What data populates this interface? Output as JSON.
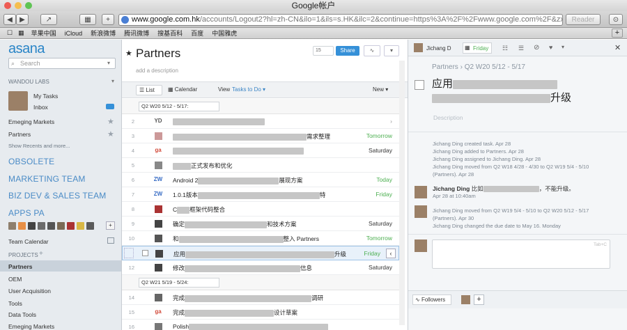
{
  "window": {
    "title": "Google帐户"
  },
  "browser": {
    "url_host": "www.google.com.hk",
    "url_rest": "/accounts/Logout2?hl=zh-CN&ilo=1&ils=s.HK&ilc=2&continue=https%3A%2F%2Fwww.google.com%2F&zx=",
    "reader": "Reader",
    "bookmarks": [
      "苹果中国",
      "iCloud",
      "新浪微博",
      "腾讯微博",
      "搜基百科",
      "百度",
      "中国雅虎"
    ]
  },
  "sidebar": {
    "logo": "asana",
    "search_placeholder": "Search",
    "workspace": "WANDOU LABS",
    "my_tasks": "My Tasks",
    "inbox": "Inbox",
    "fav1": "Emeging Markets",
    "fav2": "Partners",
    "show_recent": "Show Recents and more...",
    "teams": [
      "OBSOLETE",
      "MARKETING TEAM",
      "BIZ DEV & SALES TEAM",
      "APPS PA"
    ],
    "team_calendar": "Team Calendar",
    "projects_header": "PROJECTS",
    "projects": [
      "Partners",
      "OEM",
      "User Acquisition",
      "Tools",
      "Data Tools",
      "Emeging Markets"
    ]
  },
  "main": {
    "title": "Partners",
    "description_placeholder": "add a description",
    "follower_count": "15",
    "share": "Share",
    "view_label": "View",
    "tasks_filter": "Tasks to Do",
    "list_tab": "List",
    "calendar_tab": "Calendar",
    "new_label": "New",
    "section1": "Q2 W20 5/12 - 5/17:",
    "section2": "Q2 W21 5/19 - 5/24:",
    "rows": [
      {
        "num": "2",
        "who": "YD",
        "pre": "",
        "post": "",
        "due": ""
      },
      {
        "num": "3",
        "who": "",
        "pre": "",
        "post": "需求整理",
        "due": "Tomorrow"
      },
      {
        "num": "4",
        "who": "ga",
        "pre": "",
        "post": "",
        "due": "Saturday"
      },
      {
        "num": "5",
        "who": "",
        "pre": "",
        "post": "正式发布和优化",
        "due": ""
      },
      {
        "num": "6",
        "who": "ZW",
        "pre": "Android 2",
        "post": "展现方案",
        "due": "Today"
      },
      {
        "num": "7",
        "who": "ZW",
        "pre": "1.0.1版本",
        "post": "特",
        "due": "Friday"
      },
      {
        "num": "8",
        "who": "",
        "pre": "C",
        "post": "框架代码整合",
        "due": ""
      },
      {
        "num": "9",
        "who": "",
        "pre": "确定",
        "post": "和技术方案",
        "due": "Saturday"
      },
      {
        "num": "10",
        "who": "",
        "pre": "和",
        "post": "整入 Partners",
        "due": "Tomorrow"
      },
      {
        "num": "",
        "who": "",
        "pre": "应用",
        "post": "升级",
        "due": "Friday"
      },
      {
        "num": "12",
        "who": "",
        "pre": "修改",
        "post": "信息",
        "due": "Saturday"
      },
      {
        "num": "14",
        "who": "",
        "pre": "完成",
        "post": "调研",
        "due": ""
      },
      {
        "num": "15",
        "who": "ga",
        "pre": "完成",
        "post": "设计草案",
        "due": ""
      },
      {
        "num": "16",
        "who": "",
        "pre": "Polish",
        "post": "",
        "due": ""
      }
    ]
  },
  "detail": {
    "assignee": "Jichang D",
    "due": "Friday",
    "breadcrumb_project": "Partners",
    "breadcrumb_section": "Q2 W20 5/12 - 5/17",
    "task_title_pre": "应用",
    "task_title_post": "升级",
    "description_placeholder": "Description",
    "activity": [
      "Jichang Ding created task.  Apr 28",
      "Jichang Ding added to Partners.  Apr 28",
      "Jichang Ding assigned to Jichang Ding.  Apr 28",
      "Jichang Ding moved from Q2 W18 4/28 - 4/30 to Q2 W19 5/4 - 5/10",
      "(Partners).  Apr 28"
    ],
    "comment1_author": "Jichang Ding",
    "comment1_pre": "比如",
    "comment1_post": "，不能升级。",
    "comment1_time": "Apr 28 at 10:40am",
    "activity2": [
      "Jichang Ding moved from Q2 W19 5/4 - 5/10 to Q2 W20       5/12 - 5/17",
      "(Partners).  Apr 30",
      "Jichang Ding changed the due date to May 16.  Monday"
    ],
    "comment_placeholder": "Tab+C",
    "followers": "Followers"
  }
}
